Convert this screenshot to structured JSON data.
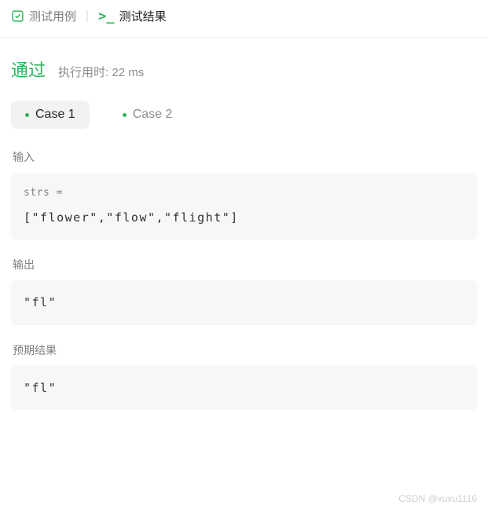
{
  "tabs": {
    "testcase_label": "测试用例",
    "result_label": "测试结果"
  },
  "status": {
    "text": "通过",
    "runtime_label": "执行用时: 22 ms"
  },
  "cases": [
    {
      "label": "Case 1",
      "active": true
    },
    {
      "label": "Case 2",
      "active": false
    }
  ],
  "sections": {
    "input": {
      "label": "输入",
      "var": "strs =",
      "value": "[\"flower\",\"flow\",\"flight\"]"
    },
    "output": {
      "label": "输出",
      "value": "\"fl\""
    },
    "expected": {
      "label": "预期结果",
      "value": "\"fl\""
    }
  },
  "watermark": "CSDN @xuxu1116"
}
